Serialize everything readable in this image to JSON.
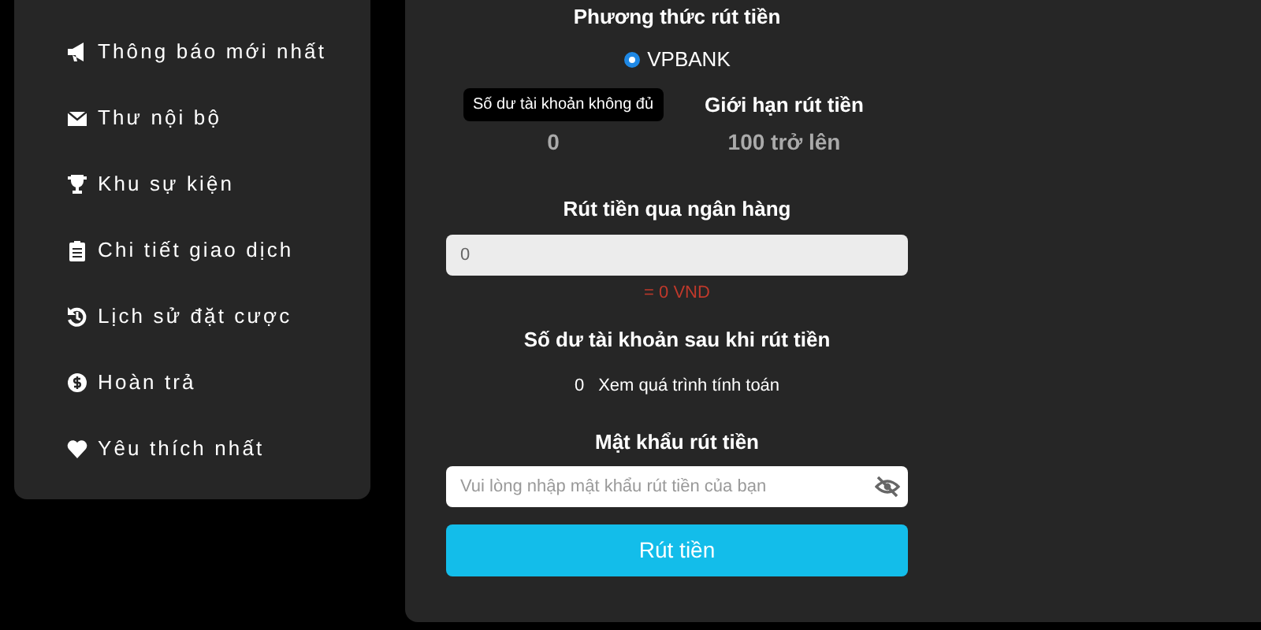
{
  "sidebar": {
    "items": [
      {
        "label": "Thông báo mới nhất"
      },
      {
        "label": "Thư nội bộ"
      },
      {
        "label": "Khu sự kiện"
      },
      {
        "label": "Chi tiết giao dịch"
      },
      {
        "label": "Lịch sử đặt cược"
      },
      {
        "label": "Hoàn trả"
      },
      {
        "label": "Yêu thích nhất"
      }
    ]
  },
  "withdraw": {
    "method_title": "Phương thức rút tiền",
    "methods": [
      {
        "label": "VPBANK",
        "selected": true
      }
    ],
    "balance": {
      "value": "0",
      "tooltip": "Số dư tài khoản không đủ"
    },
    "limit": {
      "label": "Giới hạn rút tiền",
      "value": "100 trở lên"
    },
    "amount_title": "Rút tiền qua ngân hàng",
    "amount_field": {
      "value": "0"
    },
    "converted": "= 0 VND",
    "after_title": "Số dư tài khoản sau khi rút tiền",
    "after_value": "0",
    "calc_link": "Xem quá trình tính toán",
    "password_title": "Mật khẩu rút tiền",
    "password_field": {
      "placeholder": "Vui lòng nhập mật khẩu rút tiền của bạn"
    },
    "submit": "Rút tiền"
  }
}
